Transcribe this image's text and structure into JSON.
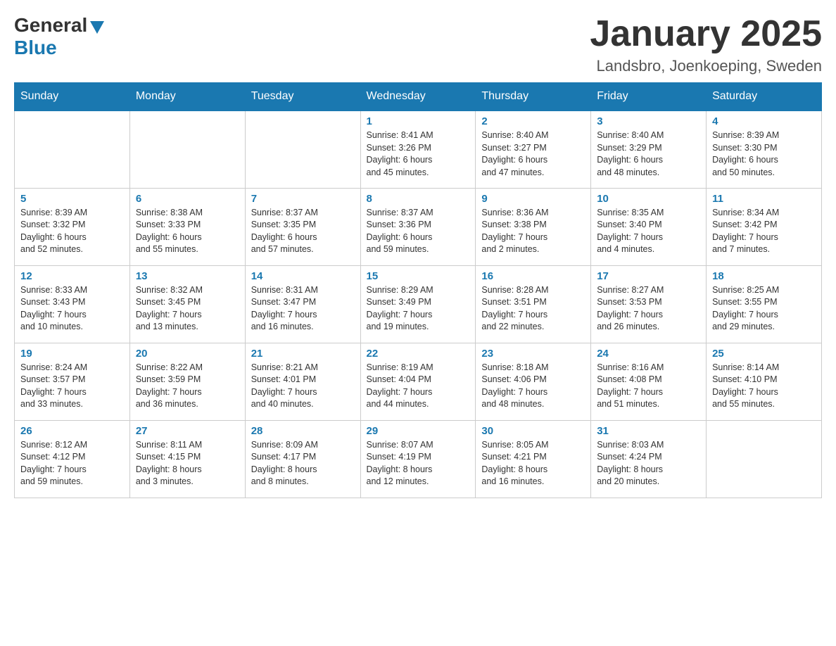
{
  "header": {
    "logo": {
      "general": "General",
      "blue": "Blue"
    },
    "title": "January 2025",
    "subtitle": "Landsbro, Joenkoeping, Sweden"
  },
  "days_of_week": [
    "Sunday",
    "Monday",
    "Tuesday",
    "Wednesday",
    "Thursday",
    "Friday",
    "Saturday"
  ],
  "weeks": [
    [
      {
        "day": "",
        "info": ""
      },
      {
        "day": "",
        "info": ""
      },
      {
        "day": "",
        "info": ""
      },
      {
        "day": "1",
        "info": "Sunrise: 8:41 AM\nSunset: 3:26 PM\nDaylight: 6 hours\nand 45 minutes."
      },
      {
        "day": "2",
        "info": "Sunrise: 8:40 AM\nSunset: 3:27 PM\nDaylight: 6 hours\nand 47 minutes."
      },
      {
        "day": "3",
        "info": "Sunrise: 8:40 AM\nSunset: 3:29 PM\nDaylight: 6 hours\nand 48 minutes."
      },
      {
        "day": "4",
        "info": "Sunrise: 8:39 AM\nSunset: 3:30 PM\nDaylight: 6 hours\nand 50 minutes."
      }
    ],
    [
      {
        "day": "5",
        "info": "Sunrise: 8:39 AM\nSunset: 3:32 PM\nDaylight: 6 hours\nand 52 minutes."
      },
      {
        "day": "6",
        "info": "Sunrise: 8:38 AM\nSunset: 3:33 PM\nDaylight: 6 hours\nand 55 minutes."
      },
      {
        "day": "7",
        "info": "Sunrise: 8:37 AM\nSunset: 3:35 PM\nDaylight: 6 hours\nand 57 minutes."
      },
      {
        "day": "8",
        "info": "Sunrise: 8:37 AM\nSunset: 3:36 PM\nDaylight: 6 hours\nand 59 minutes."
      },
      {
        "day": "9",
        "info": "Sunrise: 8:36 AM\nSunset: 3:38 PM\nDaylight: 7 hours\nand 2 minutes."
      },
      {
        "day": "10",
        "info": "Sunrise: 8:35 AM\nSunset: 3:40 PM\nDaylight: 7 hours\nand 4 minutes."
      },
      {
        "day": "11",
        "info": "Sunrise: 8:34 AM\nSunset: 3:42 PM\nDaylight: 7 hours\nand 7 minutes."
      }
    ],
    [
      {
        "day": "12",
        "info": "Sunrise: 8:33 AM\nSunset: 3:43 PM\nDaylight: 7 hours\nand 10 minutes."
      },
      {
        "day": "13",
        "info": "Sunrise: 8:32 AM\nSunset: 3:45 PM\nDaylight: 7 hours\nand 13 minutes."
      },
      {
        "day": "14",
        "info": "Sunrise: 8:31 AM\nSunset: 3:47 PM\nDaylight: 7 hours\nand 16 minutes."
      },
      {
        "day": "15",
        "info": "Sunrise: 8:29 AM\nSunset: 3:49 PM\nDaylight: 7 hours\nand 19 minutes."
      },
      {
        "day": "16",
        "info": "Sunrise: 8:28 AM\nSunset: 3:51 PM\nDaylight: 7 hours\nand 22 minutes."
      },
      {
        "day": "17",
        "info": "Sunrise: 8:27 AM\nSunset: 3:53 PM\nDaylight: 7 hours\nand 26 minutes."
      },
      {
        "day": "18",
        "info": "Sunrise: 8:25 AM\nSunset: 3:55 PM\nDaylight: 7 hours\nand 29 minutes."
      }
    ],
    [
      {
        "day": "19",
        "info": "Sunrise: 8:24 AM\nSunset: 3:57 PM\nDaylight: 7 hours\nand 33 minutes."
      },
      {
        "day": "20",
        "info": "Sunrise: 8:22 AM\nSunset: 3:59 PM\nDaylight: 7 hours\nand 36 minutes."
      },
      {
        "day": "21",
        "info": "Sunrise: 8:21 AM\nSunset: 4:01 PM\nDaylight: 7 hours\nand 40 minutes."
      },
      {
        "day": "22",
        "info": "Sunrise: 8:19 AM\nSunset: 4:04 PM\nDaylight: 7 hours\nand 44 minutes."
      },
      {
        "day": "23",
        "info": "Sunrise: 8:18 AM\nSunset: 4:06 PM\nDaylight: 7 hours\nand 48 minutes."
      },
      {
        "day": "24",
        "info": "Sunrise: 8:16 AM\nSunset: 4:08 PM\nDaylight: 7 hours\nand 51 minutes."
      },
      {
        "day": "25",
        "info": "Sunrise: 8:14 AM\nSunset: 4:10 PM\nDaylight: 7 hours\nand 55 minutes."
      }
    ],
    [
      {
        "day": "26",
        "info": "Sunrise: 8:12 AM\nSunset: 4:12 PM\nDaylight: 7 hours\nand 59 minutes."
      },
      {
        "day": "27",
        "info": "Sunrise: 8:11 AM\nSunset: 4:15 PM\nDaylight: 8 hours\nand 3 minutes."
      },
      {
        "day": "28",
        "info": "Sunrise: 8:09 AM\nSunset: 4:17 PM\nDaylight: 8 hours\nand 8 minutes."
      },
      {
        "day": "29",
        "info": "Sunrise: 8:07 AM\nSunset: 4:19 PM\nDaylight: 8 hours\nand 12 minutes."
      },
      {
        "day": "30",
        "info": "Sunrise: 8:05 AM\nSunset: 4:21 PM\nDaylight: 8 hours\nand 16 minutes."
      },
      {
        "day": "31",
        "info": "Sunrise: 8:03 AM\nSunset: 4:24 PM\nDaylight: 8 hours\nand 20 minutes."
      },
      {
        "day": "",
        "info": ""
      }
    ]
  ]
}
